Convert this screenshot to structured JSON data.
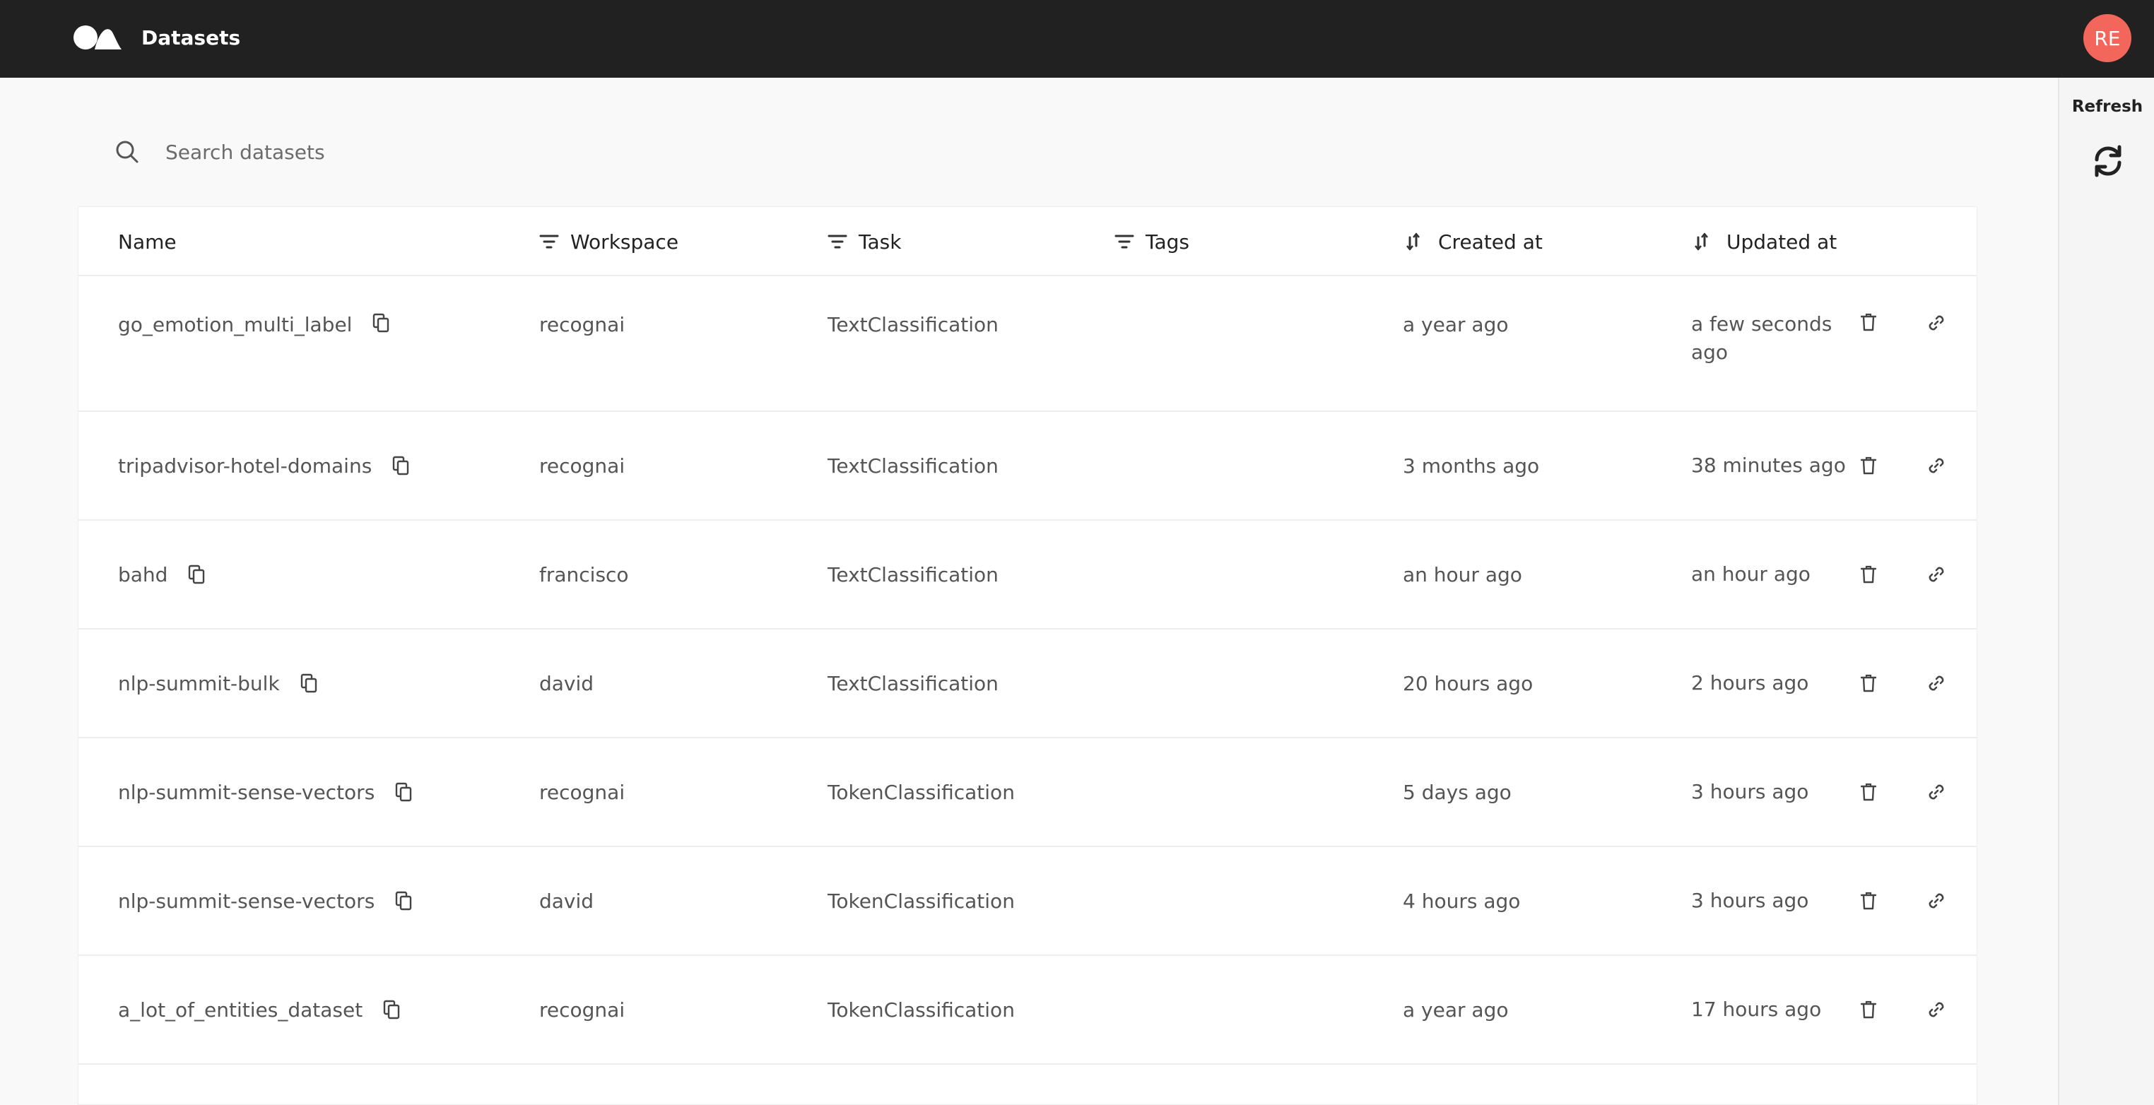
{
  "header": {
    "title": "Datasets",
    "avatar_initials": "RE"
  },
  "side_panel": {
    "refresh_label": "Refresh"
  },
  "search": {
    "placeholder": "Search datasets"
  },
  "columns": {
    "name": "Name",
    "workspace": "Workspace",
    "task": "Task",
    "tags": "Tags",
    "created": "Created at",
    "updated": "Updated at"
  },
  "rows": [
    {
      "name": "go_emotion_multi_label",
      "workspace": "recognai",
      "task": "TextClassification",
      "created": "a year ago",
      "updated": "a few seconds ago"
    },
    {
      "name": "tripadvisor-hotel-domains",
      "workspace": "recognai",
      "task": "TextClassification",
      "created": "3 months ago",
      "updated": "38 minutes ago"
    },
    {
      "name": "bahd",
      "workspace": "francisco",
      "task": "TextClassification",
      "created": "an hour ago",
      "updated": "an hour ago"
    },
    {
      "name": "nlp-summit-bulk",
      "workspace": "david",
      "task": "TextClassification",
      "created": "20 hours ago",
      "updated": "2 hours ago"
    },
    {
      "name": "nlp-summit-sense-vectors",
      "workspace": "recognai",
      "task": "TokenClassification",
      "created": "5 days ago",
      "updated": "3 hours ago"
    },
    {
      "name": "nlp-summit-sense-vectors",
      "workspace": "david",
      "task": "TokenClassification",
      "created": "4 hours ago",
      "updated": "3 hours ago"
    },
    {
      "name": "a_lot_of_entities_dataset",
      "workspace": "recognai",
      "task": "TokenClassification",
      "created": "a year ago",
      "updated": "17 hours ago"
    }
  ],
  "colors": {
    "topbar": "#212121",
    "avatar": "#f2665c",
    "background": "#f9f9f9"
  }
}
